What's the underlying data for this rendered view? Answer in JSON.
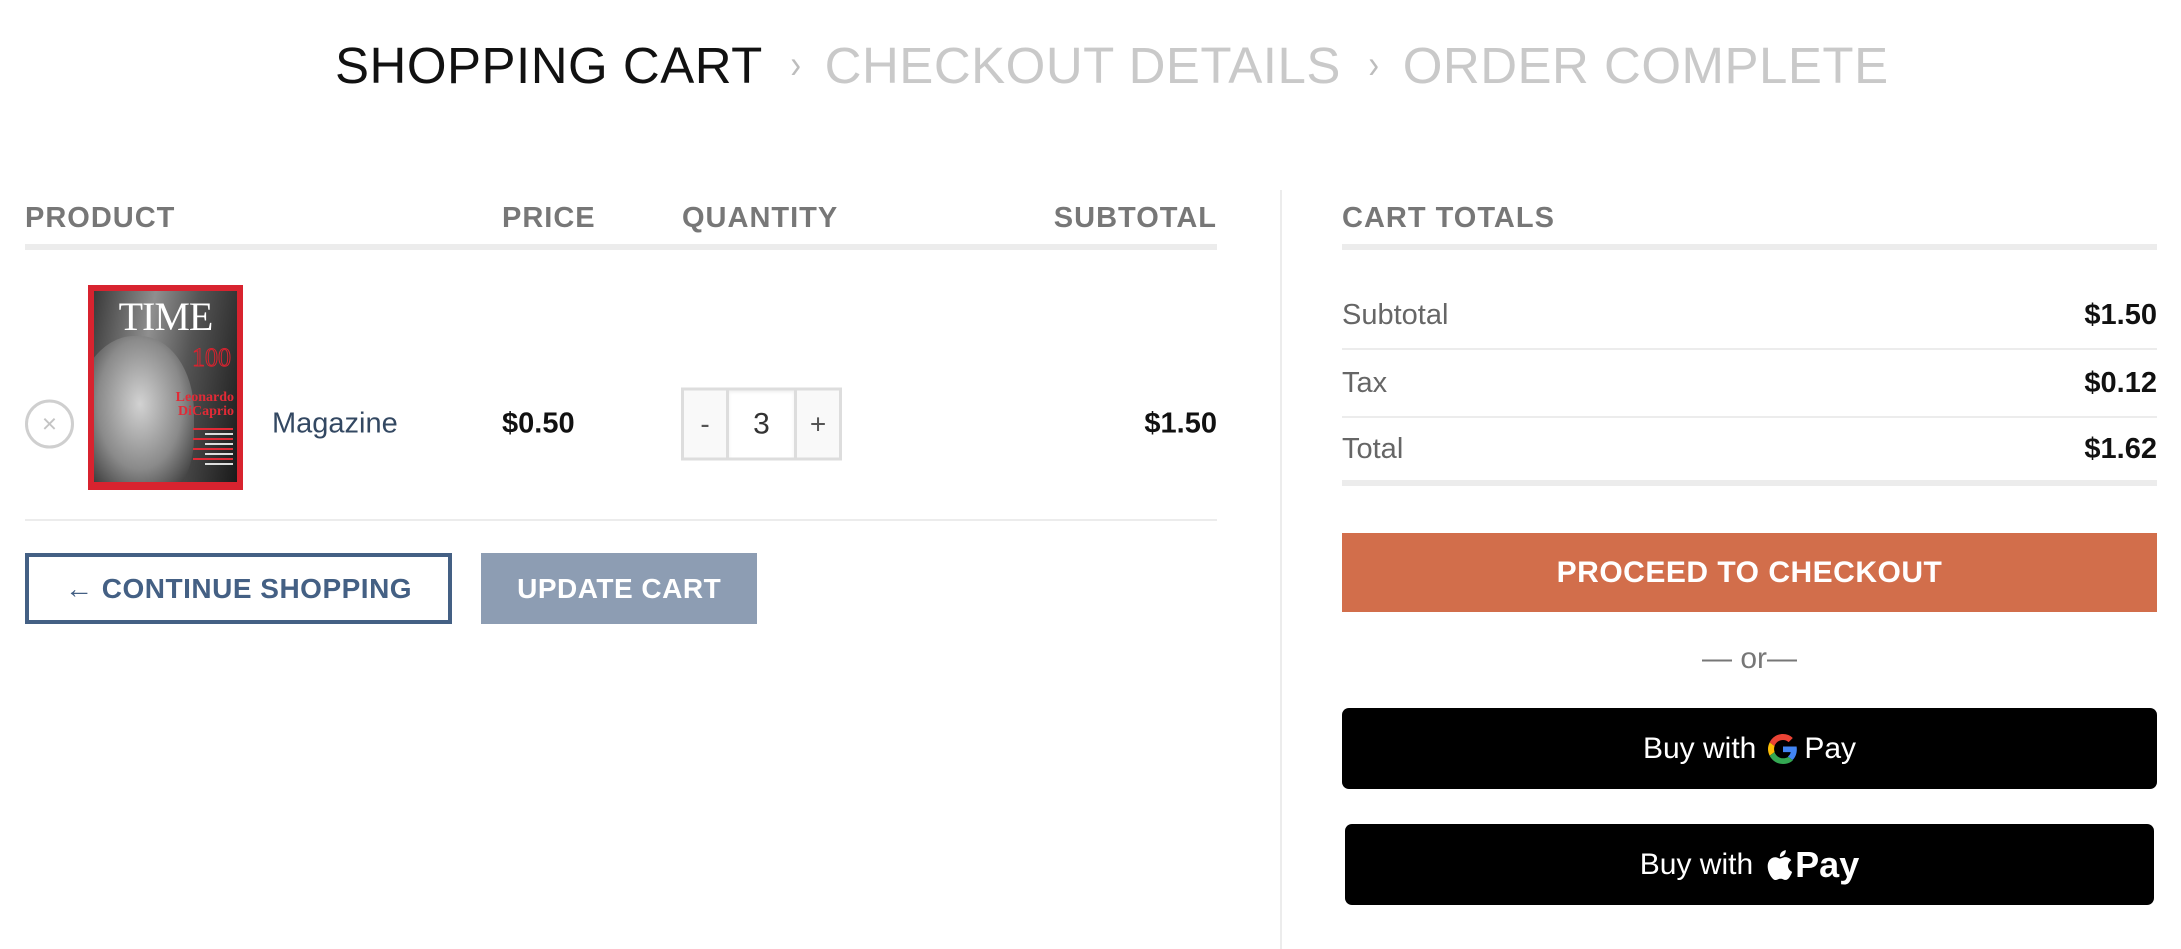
{
  "steps": {
    "items": [
      {
        "label": "SHOPPING CART",
        "active": true
      },
      {
        "label": "CHECKOUT DETAILS",
        "active": false
      },
      {
        "label": "ORDER COMPLETE",
        "active": false
      }
    ],
    "separator": "›"
  },
  "cart_table": {
    "headers": {
      "product": "PRODUCT",
      "price": "PRICE",
      "quantity": "QUANTITY",
      "subtotal": "SUBTOTAL"
    },
    "items": [
      {
        "remove_icon": "×",
        "image_alt": "TIME magazine cover",
        "cover": {
          "masthead": "TIME",
          "number": "100",
          "name_line1": "Leonardo",
          "name_line2": "DiCaprio"
        },
        "name": "Magazine",
        "price": "$0.50",
        "quantity": "3",
        "decrement": "-",
        "increment": "+",
        "subtotal": "$1.50"
      }
    ],
    "continue_label": "← CONTINUE SHOPPING",
    "update_label": "UPDATE CART"
  },
  "cart_totals": {
    "title": "CART TOTALS",
    "rows": [
      {
        "label": "Subtotal",
        "value": "$1.50"
      },
      {
        "label": "Tax",
        "value": "$0.12"
      },
      {
        "label": "Total",
        "value": "$1.62"
      }
    ],
    "checkout_label": "PROCEED TO CHECKOUT",
    "or_label": "— or—",
    "gpay": {
      "prefix": "Buy with",
      "suffix": "Pay"
    },
    "applepay": {
      "prefix": "Buy with",
      "suffix": "Pay"
    }
  },
  "colors": {
    "accent": "#446084",
    "checkout": "#d26e4b",
    "update": "#8d9db3",
    "link": "#334862"
  }
}
